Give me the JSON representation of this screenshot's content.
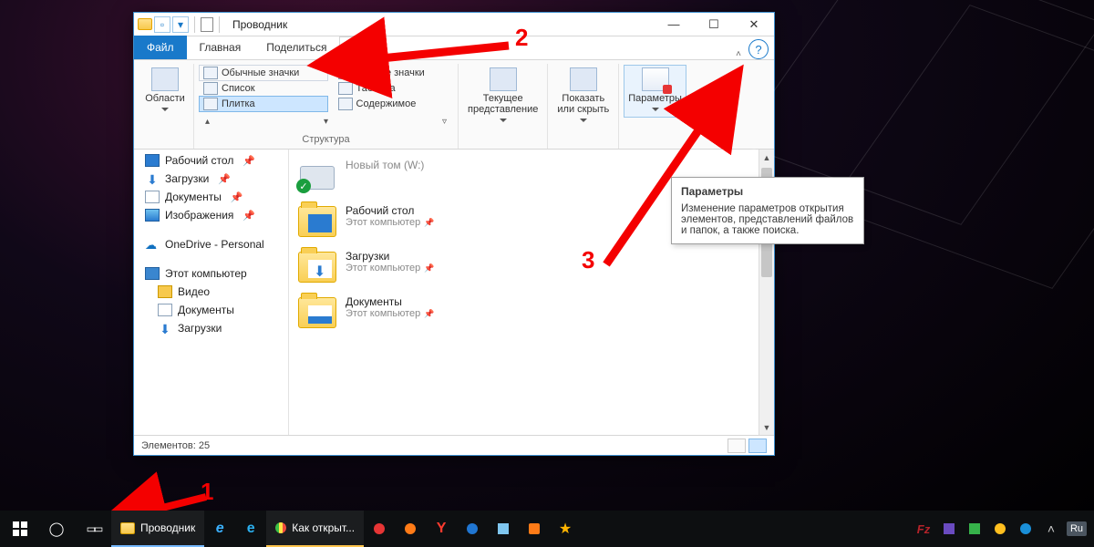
{
  "window": {
    "title": "Проводник",
    "controls": {
      "min": "—",
      "max": "☐",
      "close": "✕"
    }
  },
  "tabs": {
    "file": "Файл",
    "home": "Главная",
    "share": "Поделиться",
    "view": "Вид"
  },
  "ribbon": {
    "panes_label": "Области",
    "layout": {
      "normal": "Обычные значки",
      "small": "Мелкие значки",
      "list": "Список",
      "table": "Таблица",
      "tiles": "Плитка",
      "content": "Содержимое",
      "group": "Структура"
    },
    "current_view": "Текущее\nпредставление",
    "show_hide": "Показать\nили скрыть",
    "options": "Параметры"
  },
  "nav": {
    "desktop": "Рабочий стол",
    "downloads": "Загрузки",
    "documents": "Документы",
    "pictures": "Изображения",
    "onedrive": "OneDrive - Personal",
    "thispc": "Этот компьютер",
    "videos": "Видео",
    "documents2": "Документы",
    "downloads2": "Загрузки"
  },
  "files": {
    "drive": {
      "name": "Новый том (W:)"
    },
    "desktop": {
      "name": "Рабочий стол",
      "loc": "Этот компьютер"
    },
    "downloads": {
      "name": "Загрузки",
      "loc": "Этот компьютер"
    },
    "documents": {
      "name": "Документы",
      "loc": "Этот компьютер"
    }
  },
  "status": {
    "count_label": "Элементов: 25"
  },
  "tooltip": {
    "title": "Параметры",
    "body": "Изменение параметров открытия элементов, представлений файлов и папок, а также поиска."
  },
  "annotations": {
    "n1": "1",
    "n2": "2",
    "n3": "3"
  },
  "taskbar": {
    "explorer": "Проводник",
    "chrome_tab": "Как открыт..."
  }
}
